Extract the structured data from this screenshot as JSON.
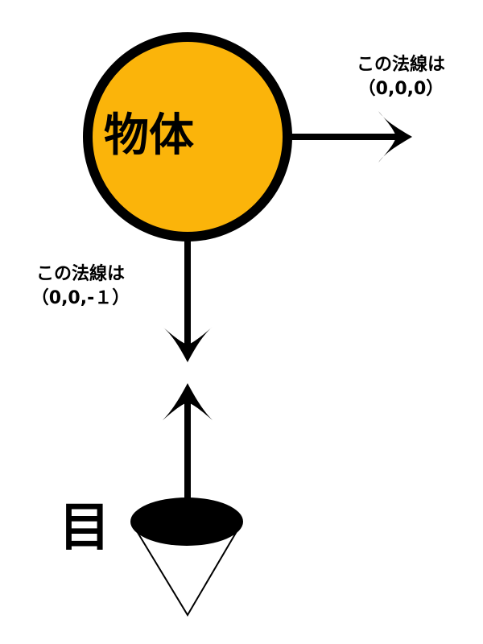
{
  "object": {
    "label": "物体",
    "fill_color": "#FBB40A",
    "stroke_color": "#000000"
  },
  "normal_right": {
    "line1": "この法線は",
    "line2": "（0,0,0）"
  },
  "normal_down": {
    "line1": "この法線は",
    "line2": "（0,0,-１）"
  },
  "eye": {
    "label": "目"
  }
}
